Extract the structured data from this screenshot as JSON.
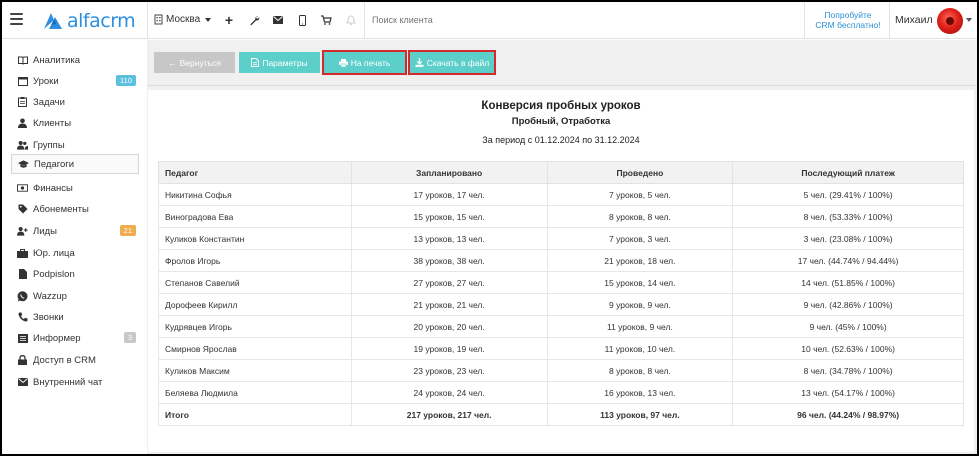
{
  "header": {
    "logo_text": "alfacrm",
    "city": "Москва",
    "search_placeholder": "Поиск клиента",
    "promo_line1": "Попробуйте",
    "promo_line2": "CRM бесплатно!",
    "user_name": "Михаил",
    "brand_color": "#2e8fe0"
  },
  "sidebar": {
    "items": [
      {
        "label": "Аналитика",
        "icon": "book-icon"
      },
      {
        "label": "Уроки",
        "icon": "calendar-icon",
        "badge": "110",
        "badge_color": "#5bc0de"
      },
      {
        "label": "Задачи",
        "icon": "clipboard-icon"
      },
      {
        "label": "Клиенты",
        "icon": "user-icon"
      },
      {
        "label": "Группы",
        "icon": "users-icon"
      },
      {
        "label": "Педагоги",
        "icon": "graduation-cap-icon",
        "active": true
      },
      {
        "label": "Финансы",
        "icon": "money-icon"
      },
      {
        "label": "Абонементы",
        "icon": "tag-icon"
      },
      {
        "label": "Лиды",
        "icon": "user-plus-icon",
        "badge": "21",
        "badge_color": "#f0ad4e"
      },
      {
        "label": "Юр. лица",
        "icon": "briefcase-icon"
      },
      {
        "label": "Podpislon",
        "icon": "file-icon"
      },
      {
        "label": "Wazzup",
        "icon": "whatsapp-icon"
      },
      {
        "label": "Звонки",
        "icon": "phone-icon"
      },
      {
        "label": "Информер",
        "icon": "list-icon",
        "badge": "3",
        "badge_color": "#c8c8c8"
      },
      {
        "label": "Доступ в CRM",
        "icon": "lock-icon"
      },
      {
        "label": "Внутренний чат",
        "icon": "envelope-icon"
      }
    ]
  },
  "toolbar": {
    "back_label": "Вернуться",
    "params_label": "Параметры",
    "print_label": "На печать",
    "download_label": "Скачать в файл"
  },
  "report": {
    "title": "Конверсия пробных уроков",
    "subtitle": "Пробный, Отработка",
    "period": "За период с 01.12.2024 по 31.12.2024",
    "columns": [
      "Педагог",
      "Запланировано",
      "Проведено",
      "Последующий платеж"
    ],
    "rows": [
      [
        "Никитина Софья",
        "17 уроков, 17 чел.",
        "7 уроков, 5 чел.",
        "5 чел. (29.41% / 100%)"
      ],
      [
        "Виноградова Ева",
        "15 уроков, 15 чел.",
        "8 уроков, 8 чел.",
        "8 чел. (53.33% / 100%)"
      ],
      [
        "Куликов Константин",
        "13 уроков, 13 чел.",
        "7 уроков, 3 чел.",
        "3 чел. (23.08% / 100%)"
      ],
      [
        "Фролов Игорь",
        "38 уроков, 38 чел.",
        "21 уроков, 18 чел.",
        "17 чел. (44.74% / 94.44%)"
      ],
      [
        "Степанов Савелий",
        "27 уроков, 27 чел.",
        "15 уроков, 14 чел.",
        "14 чел. (51.85% / 100%)"
      ],
      [
        "Дорофеев Кирилл",
        "21 уроков, 21 чел.",
        "9 уроков, 9 чел.",
        "9 чел. (42.86% / 100%)"
      ],
      [
        "Кудрявцев Игорь",
        "20 уроков, 20 чел.",
        "11 уроков, 9 чел.",
        "9 чел. (45% / 100%)"
      ],
      [
        "Смирнов Ярослав",
        "19 уроков, 19 чел.",
        "11 уроков, 10 чел.",
        "10 чел. (52.63% / 100%)"
      ],
      [
        "Куликов Максим",
        "23 уроков, 23 чел.",
        "8 уроков, 8 чел.",
        "8 чел. (34.78% / 100%)"
      ],
      [
        "Беляева Людмила",
        "24 уроков, 24 чел.",
        "16 уроков, 13 чел.",
        "13 чел. (54.17% / 100%)"
      ]
    ],
    "total": [
      "Итого",
      "217 уроков, 217 чел.",
      "113 уроков, 97 чел.",
      "96 чел. (44.24% / 98.97%)"
    ]
  }
}
